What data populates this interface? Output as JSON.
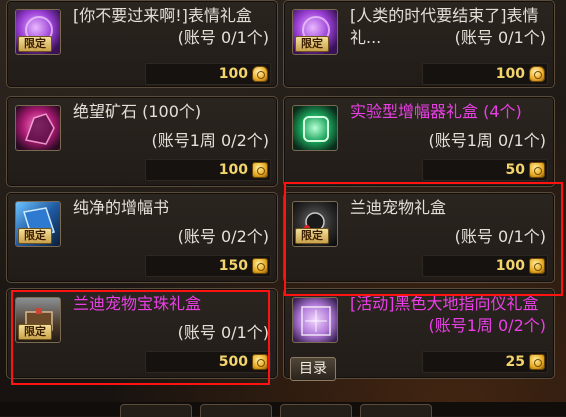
{
  "limited_label": "限定",
  "catalog_button": "目录",
  "items": [
    {
      "title": "[你不要过来啊!]表情礼盒",
      "quota": "(账号 0/1个)",
      "price": "100",
      "title_color": "white",
      "icon": "purple-orb-icon",
      "currency": "gold-bag-icon"
    },
    {
      "title": "[人类的时代要结束了]表情礼...",
      "quota": "(账号 0/1个)",
      "price": "100",
      "title_color": "white",
      "icon": "purple-orb-icon",
      "currency": "gold-bag-icon"
    },
    {
      "title": "绝望矿石 (100个)",
      "quota": "(账号1周 0/2个)",
      "price": "100",
      "title_color": "white",
      "icon": "pink-ore-icon",
      "currency": "gold-coin-icon"
    },
    {
      "title": "实验型增幅器礼盒 (4个)",
      "quota": "(账号1周 0/1个)",
      "price": "50",
      "title_color": "pink",
      "icon": "green-amplifier-icon",
      "currency": "gold-coin-icon"
    },
    {
      "title": "纯净的增幅书",
      "quota": "(账号 0/2个)",
      "price": "150",
      "title_color": "white",
      "icon": "blue-book-icon",
      "currency": "gold-coin-icon"
    },
    {
      "title": "兰迪宠物礼盒",
      "quota": "(账号 0/1个)",
      "price": "100",
      "title_color": "white",
      "icon": "dark-gift-icon",
      "currency": "gold-coin-icon"
    },
    {
      "title": "兰迪宠物宝珠礼盒",
      "quota": "(账号 0/1个)",
      "price": "500",
      "title_color": "pink",
      "icon": "pet-orb-box-icon",
      "currency": "gold-coin-icon"
    },
    {
      "title": "[活动]黑色大地指向仪礼盒",
      "quota": "(账号1周 0/2个)",
      "price": "25",
      "title_color": "pink",
      "icon": "purple-compass-box-icon",
      "currency": "gold-coin-icon"
    }
  ],
  "colors": {
    "highlight_border": "#ff1212",
    "pink_title": "#ea3fe6",
    "price": "#f3d46a"
  }
}
